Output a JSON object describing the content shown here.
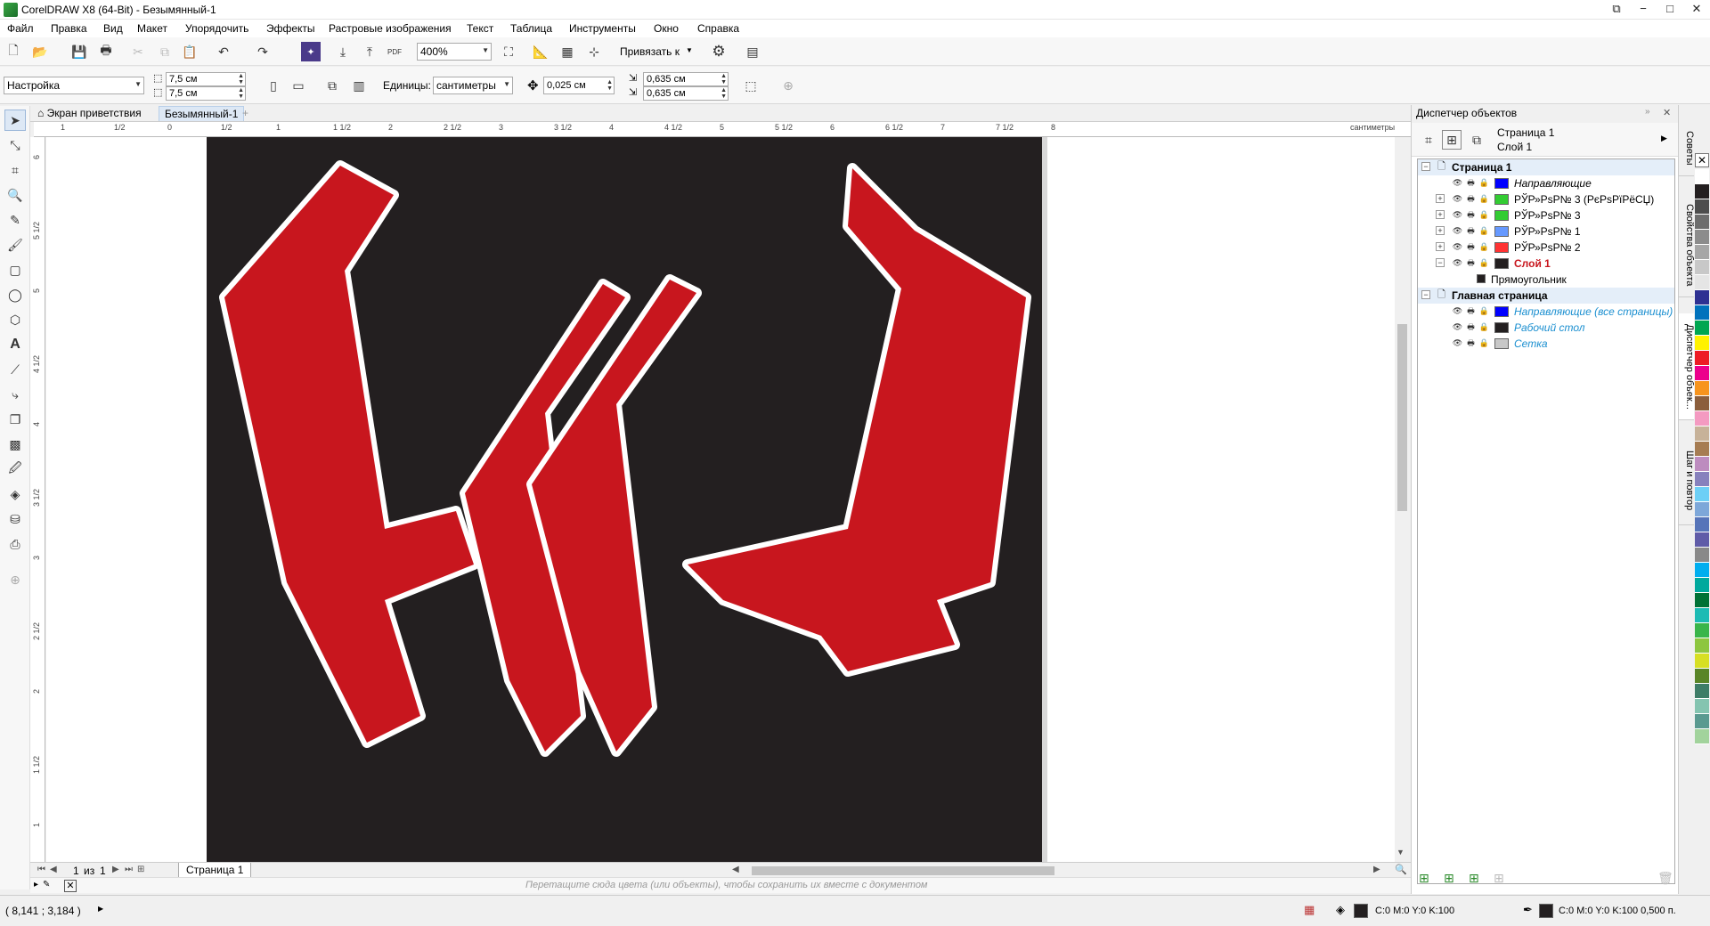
{
  "window": {
    "title": "CorelDRAW X8 (64-Bit) - Безымянный-1",
    "controls": [
      "−",
      "□",
      "✕"
    ]
  },
  "menu": [
    "Файл",
    "Правка",
    "Вид",
    "Макет",
    "Упорядочить",
    "Эффекты",
    "Растровые изображения",
    "Текст",
    "Таблица",
    "Инструменты",
    "Окно",
    "Справка"
  ],
  "std_toolbar": {
    "zoom": "400%",
    "snap_label": "Привязать к",
    "pdf_label": "PDF"
  },
  "prop_toolbar": {
    "preset": "Настройка",
    "width": "7,5 см",
    "height": "7,5 см",
    "units_label": "Единицы:",
    "units": "сантиметры",
    "nudge": "0,025 см",
    "dup_x": "0,635 см",
    "dup_y": "0,635 см"
  },
  "doc_tabs": [
    {
      "label": "Экран приветствия"
    },
    {
      "label": "Безымянный-1"
    }
  ],
  "ruler": {
    "h_labels": [
      "1",
      "1/2",
      "0",
      "1/2",
      "1",
      "1 1/2",
      "2",
      "2 1/2",
      "3",
      "3 1/2",
      "4",
      "4 1/2",
      "5",
      "5 1/2",
      "6",
      "6 1/2",
      "7",
      "7 1/2",
      "8"
    ],
    "h_unit": "сантиметры",
    "v_labels": [
      "6",
      "5 1/2",
      "5",
      "4 1/2",
      "4",
      "3 1/2",
      "3",
      "2 1/2",
      "2",
      "1 1/2",
      "1"
    ]
  },
  "page_nav": {
    "current": "1",
    "of_label": "из",
    "total": "1",
    "page_tab": "Страница 1"
  },
  "color_hint": "Перетащите сюда цвета (или объекты), чтобы сохранить их вместе с документом",
  "status": {
    "coords": "( 8,141 ; 3,184 )",
    "fill_label": "C:0 M:0 Y:0 K:100",
    "outline_label": "C:0 M:0 Y:0 K:100  0,500 п.",
    "fill_color": "#231f20",
    "outline_color": "#231f20"
  },
  "docker": {
    "title": "Диспетчер объектов",
    "current_page": "Страница 1",
    "current_layer": "Слой 1",
    "tree": [
      {
        "label": "Страница 1",
        "type": "page",
        "level": 0,
        "expanded": true,
        "bold": true,
        "highlight": true
      },
      {
        "label": "Направляющие",
        "type": "layer",
        "level": 1,
        "swatch": "#0000ff",
        "italic": true
      },
      {
        "label": "РЎР»РѕР№ 3 (РєРѕРїРёСЏ)",
        "type": "layer",
        "level": 1,
        "swatch": "#33cc33",
        "expandable": true
      },
      {
        "label": "РЎР»РѕР№ 3",
        "type": "layer",
        "level": 1,
        "swatch": "#33cc33",
        "expandable": true
      },
      {
        "label": "РЎР»РѕР№ 1",
        "type": "layer",
        "level": 1,
        "swatch": "#6699ff",
        "expandable": true
      },
      {
        "label": "РЎР»РѕР№ 2",
        "type": "layer",
        "level": 1,
        "swatch": "#ff3333",
        "expandable": true
      },
      {
        "label": "Слой 1",
        "type": "layer",
        "level": 1,
        "swatch": "#231f20",
        "expanded": true,
        "active": true
      },
      {
        "label": "Прямоугольник",
        "type": "object",
        "level": 2,
        "swatch": "#231f20"
      },
      {
        "label": "Главная страница",
        "type": "page",
        "level": 0,
        "expanded": true,
        "bold": true,
        "highlight": true
      },
      {
        "label": "Направляющие (все страницы)",
        "type": "layer",
        "level": 1,
        "swatch": "#0000ff",
        "italic": true,
        "blue": true
      },
      {
        "label": "Рабочий стол",
        "type": "layer",
        "level": 1,
        "swatch": "#231f20",
        "italic": true,
        "blue": true
      },
      {
        "label": "Сетка",
        "type": "layer",
        "level": 1,
        "swatch": "#c8c8c8",
        "italic": true,
        "blue": true
      }
    ]
  },
  "side_tabs": [
    "Советы",
    "Свойства объекта",
    "Диспетчер объек...",
    "Шаг и повтор"
  ],
  "artwork": {
    "background": "#231f20",
    "fill": "#c8161e",
    "outline": "#ffffff"
  },
  "palette": [
    "#ffffff",
    "#231f20",
    "#4d4d4d",
    "#6d6d6d",
    "#8c8c8c",
    "#a6a6a6",
    "#c8c8c8",
    "#e5e5e5",
    "#2e3192",
    "#0072bc",
    "#00a651",
    "#fff200",
    "#ed1c24",
    "#ec008c",
    "#f7941d",
    "#8b5e3c",
    "#f49ac1",
    "#c7b299",
    "#a67c52",
    "#bd8cbf",
    "#8781bd",
    "#6dcff6",
    "#7da7d9",
    "#5674b9",
    "#605ca8",
    "#898989",
    "#00aeef",
    "#00a99d",
    "#007236",
    "#1cbbb4",
    "#39b54a",
    "#8dc63f",
    "#d7df23",
    "#598527",
    "#3e7d67",
    "#84c4b0",
    "#5a9a90",
    "#a2d39c"
  ]
}
